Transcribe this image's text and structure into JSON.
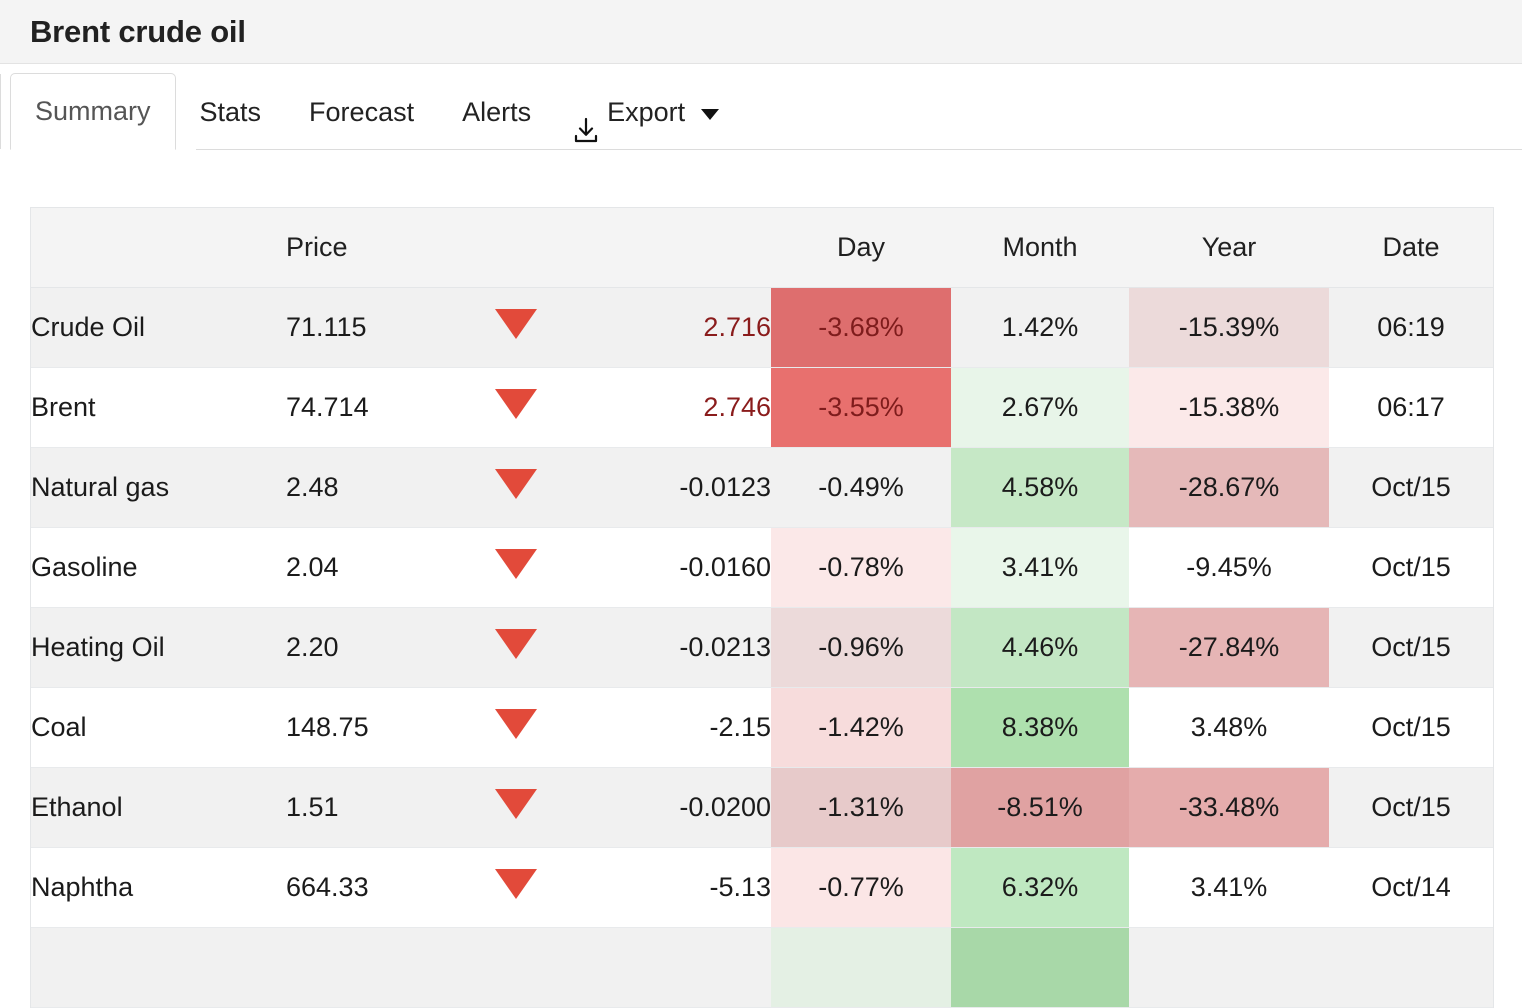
{
  "header": {
    "title": "Brent crude oil"
  },
  "tabs": [
    {
      "label": "Summary",
      "active": true,
      "icon": null
    },
    {
      "label": "Stats",
      "active": false,
      "icon": null
    },
    {
      "label": "Forecast",
      "active": false,
      "icon": null
    },
    {
      "label": "Alerts",
      "active": false,
      "icon": null
    },
    {
      "label": "Export",
      "active": false,
      "icon": "download-icon",
      "caret": true
    }
  ],
  "table": {
    "columns": [
      "",
      "Price",
      "",
      "",
      "Day",
      "Month",
      "Year",
      "Date"
    ],
    "headers": {
      "name": "",
      "price": "Price",
      "arrow": "",
      "change": "",
      "day": "Day",
      "month": "Month",
      "year": "Year",
      "date": "Date"
    },
    "rows": [
      {
        "name": "Crude Oil",
        "price": "71.115",
        "direction": "down",
        "change": "2.716",
        "change_style": "dark-red",
        "day": "-3.68%",
        "day_bg": "#de6e6e",
        "day_fg": "#7e1c1c",
        "month": "1.42%",
        "month_bg": "",
        "month_fg": "",
        "year": "-15.39%",
        "year_bg": "#ecdada",
        "year_fg": "",
        "date": "06:19"
      },
      {
        "name": "Brent",
        "price": "74.714",
        "direction": "down",
        "change": "2.746",
        "change_style": "dark-red",
        "day": "-3.55%",
        "day_bg": "#e8706e",
        "day_fg": "#7e1c1c",
        "month": "2.67%",
        "month_bg": "#e8f5e9",
        "month_fg": "",
        "year": "-15.38%",
        "year_bg": "#fbe9e9",
        "year_fg": "",
        "date": "06:17"
      },
      {
        "name": "Natural gas",
        "price": "2.48",
        "direction": "down",
        "change": "-0.0123",
        "change_style": "",
        "day": "-0.49%",
        "day_bg": "",
        "day_fg": "",
        "month": "4.58%",
        "month_bg": "#c6e8c6",
        "month_fg": "",
        "year": "-28.67%",
        "year_bg": "#e5b9b9",
        "year_fg": "",
        "date": "Oct/15"
      },
      {
        "name": "Gasoline",
        "price": "2.04",
        "direction": "down",
        "change": "-0.0160",
        "change_style": "",
        "day": "-0.78%",
        "day_bg": "#fbe8e8",
        "day_fg": "",
        "month": "3.41%",
        "month_bg": "#e9f6ea",
        "month_fg": "",
        "year": "-9.45%",
        "year_bg": "",
        "year_fg": "",
        "date": "Oct/15"
      },
      {
        "name": "Heating Oil",
        "price": "2.20",
        "direction": "down",
        "change": "-0.0213",
        "change_style": "",
        "day": "-0.96%",
        "day_bg": "#ecdada",
        "day_fg": "",
        "month": "4.46%",
        "month_bg": "#c3e7c4",
        "month_fg": "",
        "year": "-27.84%",
        "year_bg": "#e6b5b5",
        "year_fg": "",
        "date": "Oct/15"
      },
      {
        "name": "Coal",
        "price": "148.75",
        "direction": "down",
        "change": "-2.15",
        "change_style": "",
        "day": "-1.42%",
        "day_bg": "#f7dcdc",
        "day_fg": "",
        "month": "8.38%",
        "month_bg": "#aee0ae",
        "month_fg": "",
        "year": "3.48%",
        "year_bg": "",
        "year_fg": "",
        "date": "Oct/15"
      },
      {
        "name": "Ethanol",
        "price": "1.51",
        "direction": "down",
        "change": "-0.0200",
        "change_style": "",
        "day": "-1.31%",
        "day_bg": "#e7caca",
        "day_fg": "",
        "month": "-8.51%",
        "month_bg": "#e0a2a2",
        "month_fg": "",
        "year": "-33.48%",
        "year_bg": "#e5acac",
        "year_fg": "",
        "date": "Oct/15"
      },
      {
        "name": "Naphtha",
        "price": "664.33",
        "direction": "down",
        "change": "-5.13",
        "change_style": "",
        "day": "-0.77%",
        "day_bg": "#fbe6e6",
        "day_fg": "",
        "month": "6.32%",
        "month_bg": "#bfe8c1",
        "month_fg": "",
        "year": "3.41%",
        "year_bg": "",
        "year_fg": "",
        "date": "Oct/14"
      },
      {
        "name": "",
        "price": "",
        "direction": "none",
        "change": "",
        "change_style": "",
        "day": "",
        "day_bg": "#e4f0e4",
        "day_fg": "",
        "month": "",
        "month_bg": "#a8d8a8",
        "month_fg": "",
        "year": "",
        "year_bg": "",
        "year_fg": "",
        "date": ""
      }
    ]
  },
  "colors": {
    "title_bar_bg": "#f4f4f4",
    "header_bg": "#f4f4f4",
    "zebra_bg": "#f1f1f1",
    "border": "#e4e6e8",
    "arrow_down": "#e24a3a",
    "change_negative_text": "#8a1c1c"
  }
}
